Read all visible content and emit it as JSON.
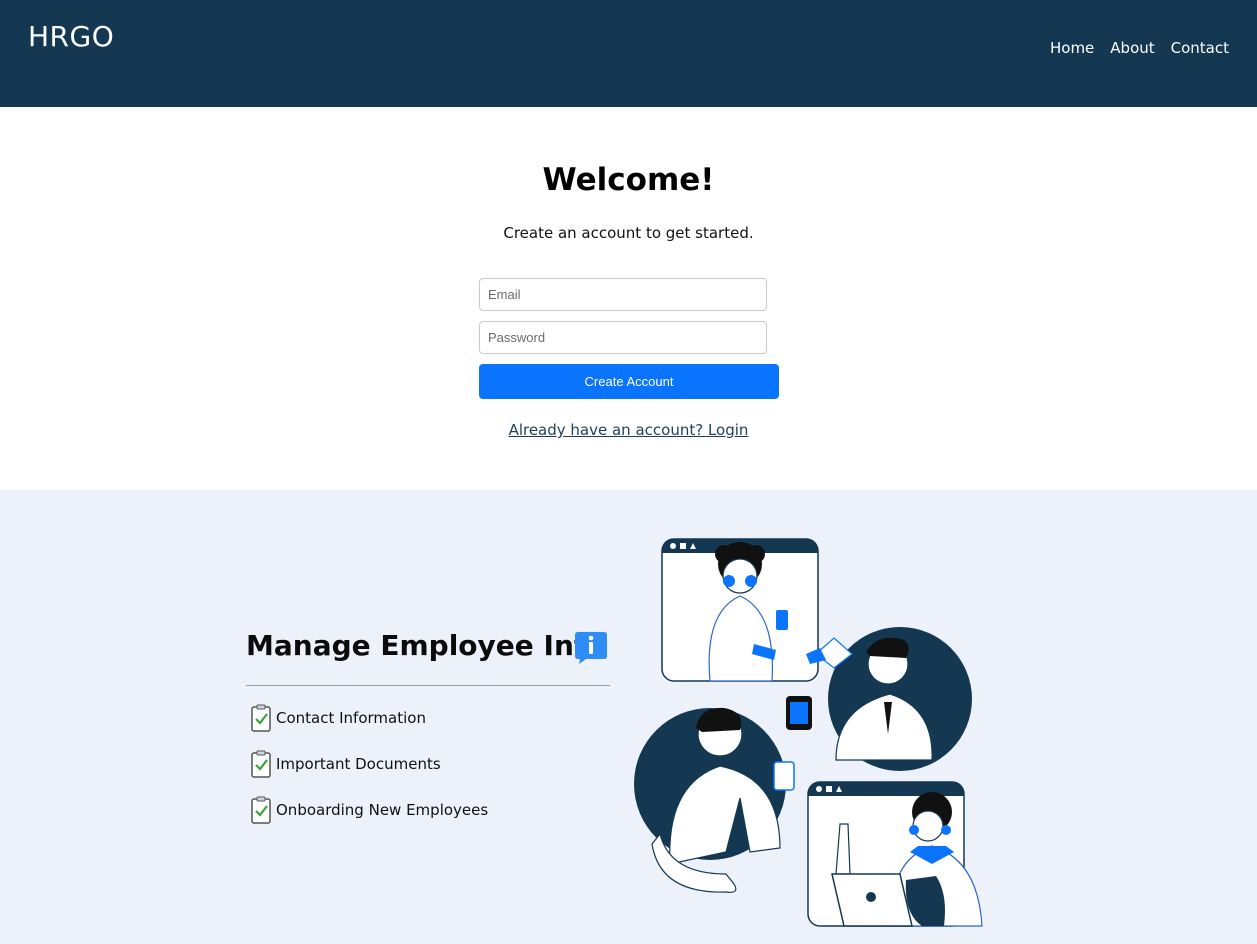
{
  "nav": {
    "brand": "HRGO",
    "links": [
      "Home",
      "About",
      "Contact"
    ]
  },
  "signup": {
    "title": "Welcome!",
    "subtitle": "Create an account to get started.",
    "email_placeholder": "Email",
    "password_placeholder": "Password",
    "button_label": "Create Account",
    "login_link": "Already have an account? Login"
  },
  "features": {
    "title": "Manage Employee Info",
    "items": [
      "Contact Information",
      "Important Documents",
      "Onboarding New Employees"
    ]
  },
  "icons": {
    "info": "info-chat-icon",
    "check": "clipboard-check-icon"
  },
  "colors": {
    "nav_bg": "#143852",
    "accent": "#0a74ff",
    "features_bg": "#edf1fa",
    "check_green": "#3aa23a"
  }
}
